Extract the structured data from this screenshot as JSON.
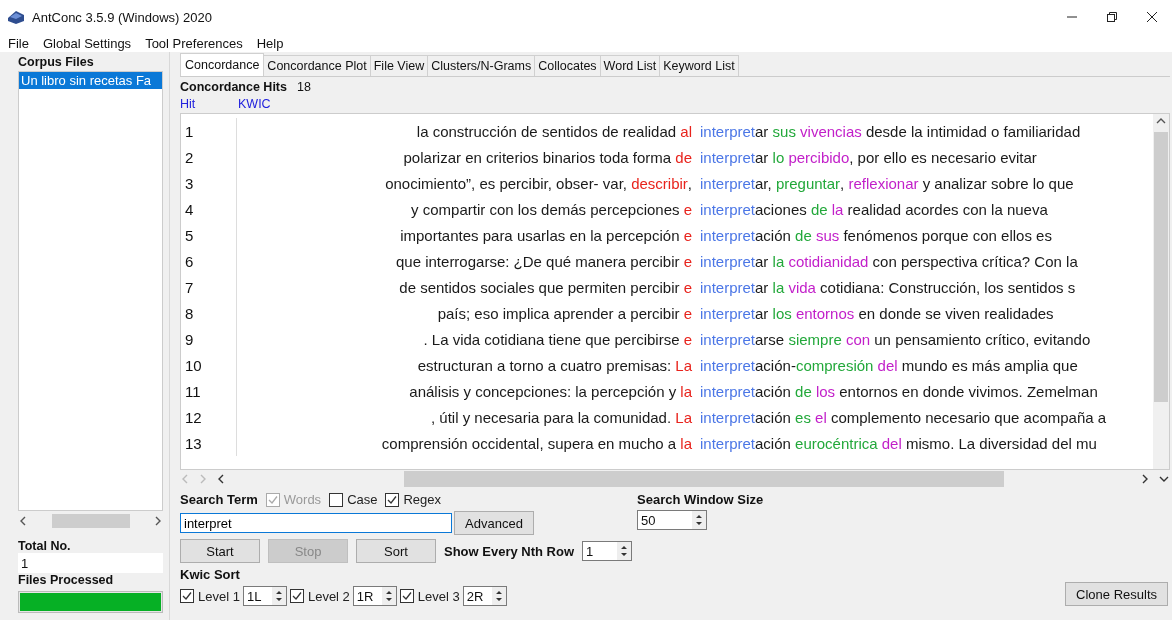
{
  "window": {
    "title": "AntConc 3.5.9 (Windows) 2020"
  },
  "menu": [
    "File",
    "Global Settings",
    "Tool Preferences",
    "Help"
  ],
  "corpus_files": {
    "heading": "Corpus Files",
    "files": [
      {
        "name": "Un libro sin recetas Fa",
        "selected": true
      }
    ]
  },
  "total_no": {
    "label": "Total No.",
    "value": "1"
  },
  "files_processed": {
    "label": "Files Processed",
    "level": 1
  },
  "tabs": [
    {
      "label": "Concordance",
      "selected": true
    },
    {
      "label": "Concordance Plot",
      "selected": false
    },
    {
      "label": "File View",
      "selected": false
    },
    {
      "label": "Clusters/N-Grams",
      "selected": false
    },
    {
      "label": "Collocates",
      "selected": false
    },
    {
      "label": "Word List",
      "selected": false
    },
    {
      "label": "Keyword List",
      "selected": false
    }
  ],
  "concordance": {
    "hits_label": "Concordance Hits",
    "hits": "18",
    "columns": [
      "Hit",
      "KWIC"
    ],
    "rows": [
      {
        "hit": "1",
        "segments": [
          {
            "kind": "context",
            "text": "la construcción de sentidos de realidad "
          },
          {
            "kind": "l1",
            "text": "al"
          },
          {
            "kind": "node",
            "text": "interpret"
          },
          {
            "kind": "context",
            "text": "ar "
          },
          {
            "kind": "r1",
            "text": "sus "
          },
          {
            "kind": "r2",
            "text": "vivencias"
          },
          {
            "kind": "context",
            "text": " desde la intimidad o familiaridad"
          }
        ]
      },
      {
        "hit": "2",
        "segments": [
          {
            "kind": "context",
            "text": "polarizar en criterios binarios toda forma "
          },
          {
            "kind": "l1",
            "text": "de"
          },
          {
            "kind": "node",
            "text": "interpret"
          },
          {
            "kind": "context",
            "text": "ar "
          },
          {
            "kind": "r1",
            "text": "lo "
          },
          {
            "kind": "r2",
            "text": "percibido"
          },
          {
            "kind": "context",
            "text": ", por ello es necesario evitar"
          }
        ]
      },
      {
        "hit": "3",
        "segments": [
          {
            "kind": "context",
            "text": "onocimiento”, es percibir, obser- var, "
          },
          {
            "kind": "l1",
            "text": "describir"
          },
          {
            "kind": "context",
            "text": ","
          },
          {
            "kind": "node",
            "text": "interpret"
          },
          {
            "kind": "context",
            "text": "ar, "
          },
          {
            "kind": "r1",
            "text": "preguntar"
          },
          {
            "kind": "context",
            "text": ", "
          },
          {
            "kind": "r2",
            "text": "reflexionar"
          },
          {
            "kind": "context",
            "text": " y analizar sobre lo que"
          }
        ]
      },
      {
        "hit": "4",
        "segments": [
          {
            "kind": "context",
            "text": "y compartir con los demás percepciones "
          },
          {
            "kind": "l1",
            "text": "e"
          },
          {
            "kind": "node",
            "text": "interpret"
          },
          {
            "kind": "context",
            "text": "aciones "
          },
          {
            "kind": "r1",
            "text": "de "
          },
          {
            "kind": "r2",
            "text": "la"
          },
          {
            "kind": "context",
            "text": " realidad acordes con la nueva"
          }
        ]
      },
      {
        "hit": "5",
        "segments": [
          {
            "kind": "context",
            "text": "importantes para usarlas en la percepción "
          },
          {
            "kind": "l1",
            "text": "e"
          },
          {
            "kind": "node",
            "text": "interpret"
          },
          {
            "kind": "context",
            "text": "ación "
          },
          {
            "kind": "r1",
            "text": "de "
          },
          {
            "kind": "r2",
            "text": "sus"
          },
          {
            "kind": "context",
            "text": " fenómenos porque con ellos es"
          }
        ]
      },
      {
        "hit": "6",
        "segments": [
          {
            "kind": "context",
            "text": "que interrogarse: ¿De qué manera percibir "
          },
          {
            "kind": "l1",
            "text": "e"
          },
          {
            "kind": "node",
            "text": "interpret"
          },
          {
            "kind": "context",
            "text": "ar "
          },
          {
            "kind": "r1",
            "text": "la "
          },
          {
            "kind": "r2",
            "text": "cotidianidad"
          },
          {
            "kind": "context",
            "text": " con perspectiva crítica? Con la"
          }
        ]
      },
      {
        "hit": "7",
        "segments": [
          {
            "kind": "context",
            "text": "de sentidos sociales que permiten percibir "
          },
          {
            "kind": "l1",
            "text": "e"
          },
          {
            "kind": "node",
            "text": "interpret"
          },
          {
            "kind": "context",
            "text": "ar "
          },
          {
            "kind": "r1",
            "text": "la "
          },
          {
            "kind": "r2",
            "text": "vida"
          },
          {
            "kind": "context",
            "text": " cotidiana: Construcción, los sentidos s"
          }
        ]
      },
      {
        "hit": "8",
        "segments": [
          {
            "kind": "context",
            "text": "país; eso implica aprender a percibir "
          },
          {
            "kind": "l1",
            "text": "e"
          },
          {
            "kind": "node",
            "text": "interpret"
          },
          {
            "kind": "context",
            "text": "ar "
          },
          {
            "kind": "r1",
            "text": "los "
          },
          {
            "kind": "r2",
            "text": "entornos"
          },
          {
            "kind": "context",
            "text": " en donde se viven realidades"
          }
        ]
      },
      {
        "hit": "9",
        "segments": [
          {
            "kind": "context",
            "text": ". La vida cotidiana tiene que percibirse "
          },
          {
            "kind": "l1",
            "text": "e"
          },
          {
            "kind": "node",
            "text": "interpret"
          },
          {
            "kind": "context",
            "text": "arse "
          },
          {
            "kind": "r1",
            "text": "siempre "
          },
          {
            "kind": "r2",
            "text": "con"
          },
          {
            "kind": "context",
            "text": " un pensamiento crítico, evitando"
          }
        ]
      },
      {
        "hit": "10",
        "segments": [
          {
            "kind": "context",
            "text": "estructuran a torno a cuatro premisas: "
          },
          {
            "kind": "l1",
            "text": "La"
          },
          {
            "kind": "node",
            "text": "interpret"
          },
          {
            "kind": "context",
            "text": "ación-"
          },
          {
            "kind": "r1",
            "text": "compresión "
          },
          {
            "kind": "r2",
            "text": "del"
          },
          {
            "kind": "context",
            "text": " mundo es más amplia que"
          }
        ]
      },
      {
        "hit": "11",
        "segments": [
          {
            "kind": "context",
            "text": "análisis y concepciones: la percepción y "
          },
          {
            "kind": "l1",
            "text": "la"
          },
          {
            "kind": "node",
            "text": "interpret"
          },
          {
            "kind": "context",
            "text": "ación "
          },
          {
            "kind": "r1",
            "text": "de "
          },
          {
            "kind": "r2",
            "text": "los"
          },
          {
            "kind": "context",
            "text": " entornos en donde vivimos. Zemelman"
          }
        ]
      },
      {
        "hit": "12",
        "segments": [
          {
            "kind": "context",
            "text": ", útil y necesaria para la comunidad. "
          },
          {
            "kind": "l1",
            "text": "La"
          },
          {
            "kind": "node",
            "text": "interpret"
          },
          {
            "kind": "context",
            "text": "ación "
          },
          {
            "kind": "r1",
            "text": "es "
          },
          {
            "kind": "r2",
            "text": "el"
          },
          {
            "kind": "context",
            "text": " complemento necesario que acompaña a"
          }
        ]
      },
      {
        "hit": "13",
        "segments": [
          {
            "kind": "context",
            "text": "comprensión occidental, supera en mucho a "
          },
          {
            "kind": "l1",
            "text": "la"
          },
          {
            "kind": "node",
            "text": "interpret"
          },
          {
            "kind": "context",
            "text": "ación "
          },
          {
            "kind": "r1",
            "text": "eurocéntrica "
          },
          {
            "kind": "r2",
            "text": "del"
          },
          {
            "kind": "context",
            "text": " mismo. La diversidad del mu"
          }
        ]
      }
    ]
  },
  "search": {
    "label": "Search Term",
    "options": [
      {
        "label": "Words",
        "checked": true,
        "disabled": true
      },
      {
        "label": "Case",
        "checked": false,
        "disabled": false
      },
      {
        "label": "Regex",
        "checked": true,
        "disabled": false
      }
    ],
    "value": "interpret",
    "advanced": "Advanced"
  },
  "buttons": [
    {
      "label": "Start",
      "disabled": false
    },
    {
      "label": "Stop",
      "disabled": true
    },
    {
      "label": "Sort",
      "disabled": false
    }
  ],
  "nth_row": {
    "label": "Show Every Nth Row",
    "value": "1"
  },
  "window_size": {
    "label": "Search Window Size",
    "value": "50"
  },
  "kwic_sort": {
    "label": "Kwic Sort",
    "levels": [
      {
        "label": "Level 1",
        "checked": true,
        "value": "1L"
      },
      {
        "label": "Level 2",
        "checked": true,
        "value": "1R"
      },
      {
        "label": "Level 3",
        "checked": true,
        "value": "2R"
      }
    ]
  },
  "clone_button": "Clone Results"
}
